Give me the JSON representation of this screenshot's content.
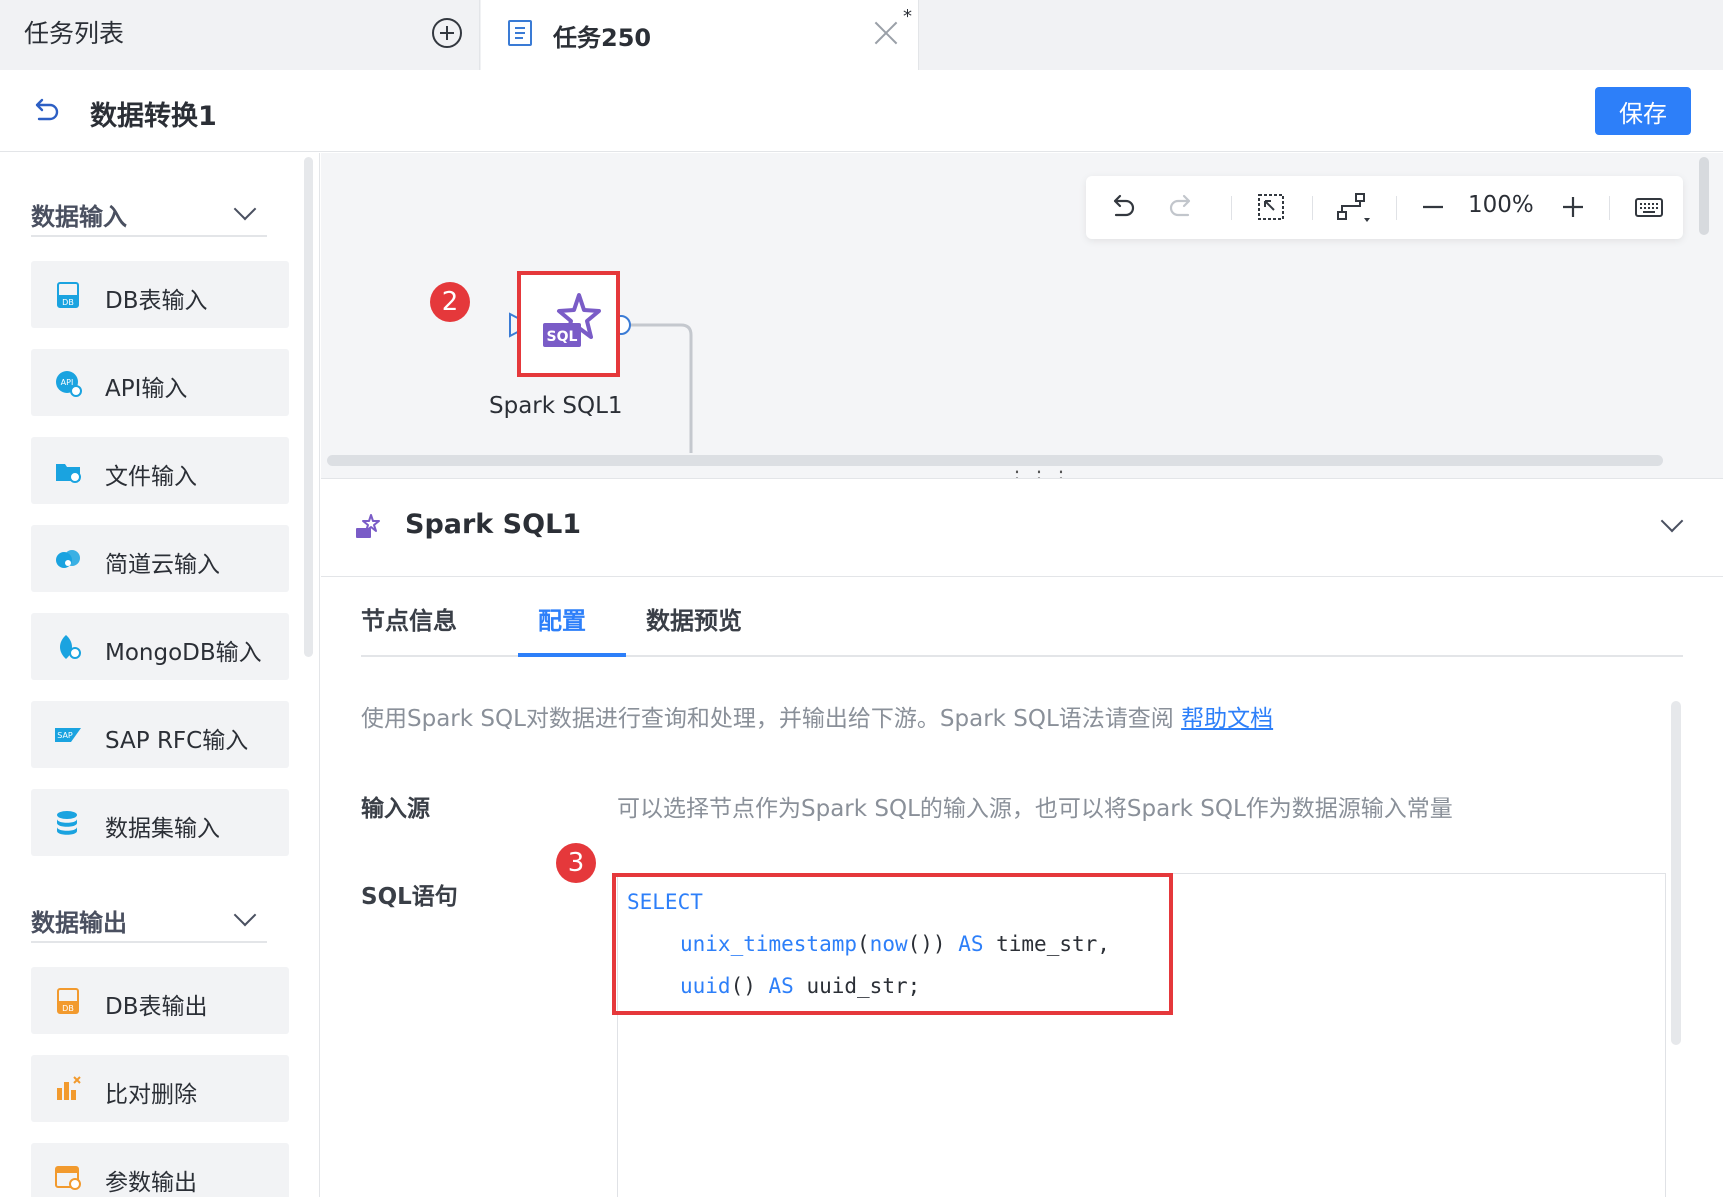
{
  "tabs": {
    "list_label": "任务列表",
    "active_label": "任务250",
    "modified_marker": "*"
  },
  "header": {
    "title": "数据转换1",
    "save_label": "保存"
  },
  "sidebar": {
    "sections": [
      {
        "title": "数据输入",
        "items": [
          "DB表输入",
          "API输入",
          "文件输入",
          "简道云输入",
          "MongoDB输入",
          "SAP RFC输入",
          "数据集输入"
        ]
      },
      {
        "title": "数据输出",
        "items": [
          "DB表输出",
          "比对删除",
          "参数输出"
        ]
      }
    ]
  },
  "toolbar": {
    "zoom": "100%"
  },
  "canvas": {
    "node_label": "Spark SQL1",
    "badge_node": "2",
    "node_icon_text": "SQL"
  },
  "panel": {
    "title": "Spark SQL1",
    "tabs": [
      "节点信息",
      "配置",
      "数据预览"
    ],
    "active_tab": "配置",
    "description": "使用Spark SQL对数据进行查询和处理，并输出给下游。Spark SQL语法请查阅",
    "help_link": "帮助文档",
    "input_source_label": "输入源",
    "input_source_hint": "可以选择节点作为Spark SQL的输入源，也可以将Spark SQL作为数据源输入常量",
    "sql_label": "SQL语句",
    "badge_sql": "3",
    "code": {
      "line1_kw": "SELECT",
      "line2_fn1": "unix_timestamp",
      "line2_p1": "(",
      "line2_fn2": "now",
      "line2_p2": "()) ",
      "line2_kw": "AS",
      "line2_rest": " time_str,",
      "line3_fn": "uuid",
      "line3_p": "() ",
      "line3_kw": "AS",
      "line3_rest": " uuid_str;"
    }
  },
  "colors": {
    "accent": "#2d7ff9",
    "highlight": "#e5383b",
    "node_purple": "#7a5cc7"
  }
}
